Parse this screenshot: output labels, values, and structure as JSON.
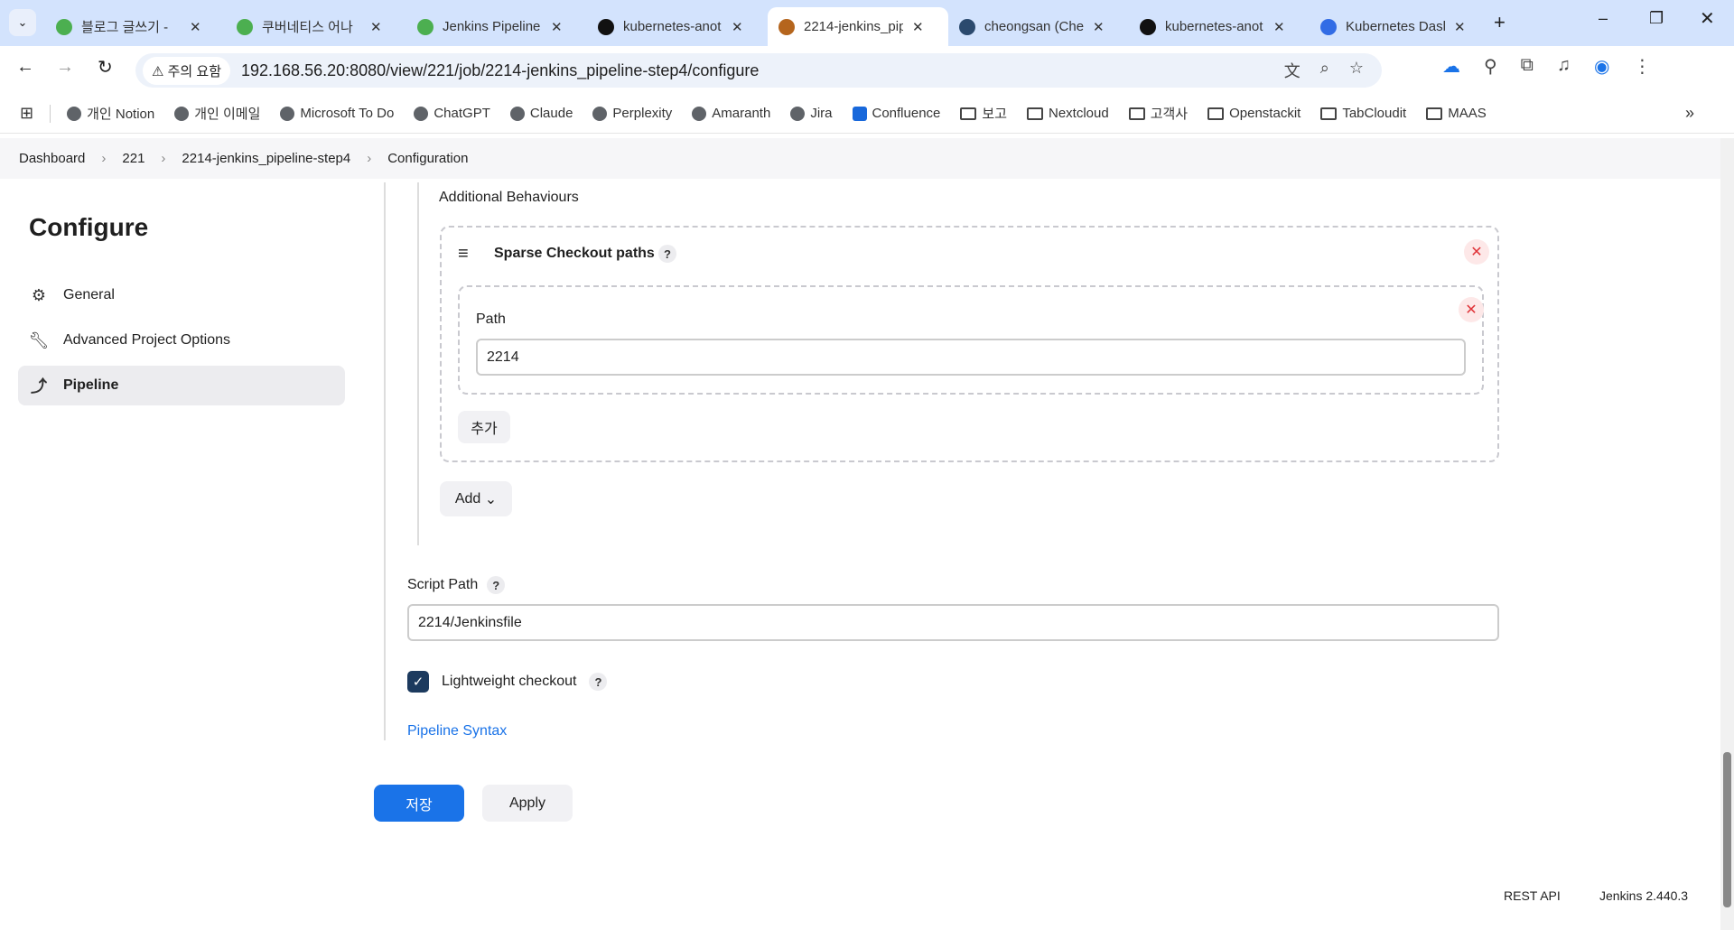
{
  "browser": {
    "tabs": [
      {
        "title": "블로그 글쓰기 -",
        "color": "#4caf50"
      },
      {
        "title": "쿠버네티스 어나",
        "color": "#4caf50"
      },
      {
        "title": "Jenkins Pipeline",
        "color": "#4caf50"
      },
      {
        "title": "kubernetes-anot",
        "color": "#111111"
      },
      {
        "title": "2214-jenkins_pip",
        "color": "#b5651d",
        "active": true
      },
      {
        "title": "cheongsan (Che",
        "color": "#2b4a6e"
      },
      {
        "title": "kubernetes-anot",
        "color": "#111111"
      },
      {
        "title": "Kubernetes Dasl",
        "color": "#326ce5"
      }
    ],
    "security_label": "주의 요함",
    "url": "192.168.56.20:8080/view/221/job/2214-jenkins_pipeline-step4/configure",
    "bookmarks": [
      {
        "label": "개인 Notion",
        "type": "globe"
      },
      {
        "label": "개인 이메일",
        "type": "globe"
      },
      {
        "label": "Microsoft To Do",
        "type": "globe"
      },
      {
        "label": "ChatGPT",
        "type": "globe"
      },
      {
        "label": "Claude",
        "type": "globe"
      },
      {
        "label": "Perplexity",
        "type": "globe"
      },
      {
        "label": "Amaranth",
        "type": "globe"
      },
      {
        "label": "Jira",
        "type": "globe"
      },
      {
        "label": "Confluence",
        "type": "confluence"
      },
      {
        "label": "보고",
        "type": "folder"
      },
      {
        "label": "Nextcloud",
        "type": "folder"
      },
      {
        "label": "고객사",
        "type": "folder"
      },
      {
        "label": "Openstackit",
        "type": "folder"
      },
      {
        "label": "TabCloudit",
        "type": "folder"
      },
      {
        "label": "MAAS",
        "type": "folder"
      }
    ]
  },
  "breadcrumb": [
    "Dashboard",
    "221",
    "2214-jenkins_pipeline-step4",
    "Configuration"
  ],
  "sidebar": {
    "title": "Configure",
    "items": [
      {
        "label": "General"
      },
      {
        "label": "Advanced Project Options"
      },
      {
        "label": "Pipeline"
      }
    ]
  },
  "main": {
    "additional_behaviours": "Additional Behaviours",
    "sparse_title": "Sparse Checkout paths",
    "path_label": "Path",
    "path_value": "2214",
    "add_path_button": "추가",
    "add_button": "Add",
    "script_path_label": "Script Path",
    "script_path_value": "2214/Jenkinsfile",
    "lightweight_label": "Lightweight checkout",
    "lightweight_checked": true,
    "pipeline_syntax": "Pipeline Syntax",
    "save": "저장",
    "apply": "Apply"
  },
  "footer": {
    "rest_api": "REST API",
    "version": "Jenkins 2.440.3"
  }
}
